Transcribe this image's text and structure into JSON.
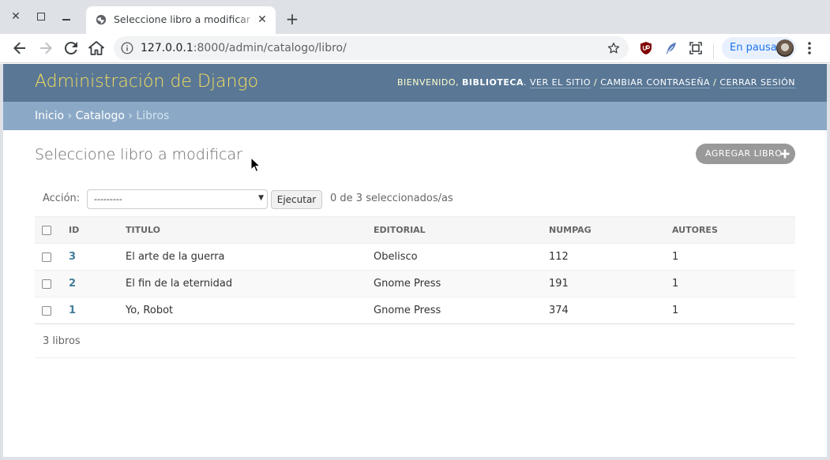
{
  "browser": {
    "tab_title": "Seleccione libro a modificar | Sitio de administración de Django",
    "url_host": "127.0.0.1",
    "url_rest": ":8000/admin/catalogo/libro/",
    "profile_label": "En pausa"
  },
  "header": {
    "brand": "Administración de Django",
    "welcome": "Bienvenido,",
    "username": "biblioteca",
    "view_site": "Ver el sitio",
    "change_password": "Cambiar contraseña",
    "logout": "Cerrar sesión",
    "sep": "/"
  },
  "breadcrumbs": {
    "home": "Inicio",
    "app": "Catalogo",
    "current": "Libros",
    "sep": "›"
  },
  "content": {
    "title": "Seleccione libro a modificar",
    "add_button": "Agregar libro"
  },
  "actions": {
    "label": "Acción:",
    "selected_option": "---------",
    "go_button": "Ejecutar",
    "counter": "0 de 3 seleccionados/as"
  },
  "table": {
    "columns": [
      "ID",
      "TITULO",
      "EDITORIAL",
      "NUMPAG",
      "AUTORES"
    ],
    "rows": [
      {
        "id": "3",
        "titulo": "El arte de la guerra",
        "editorial": "Obelisco",
        "numpag": "112",
        "autores": "1"
      },
      {
        "id": "2",
        "titulo": "El fin de la eternidad",
        "editorial": "Gnome Press",
        "numpag": "191",
        "autores": "1"
      },
      {
        "id": "1",
        "titulo": "Yo, Robot",
        "editorial": "Gnome Press",
        "numpag": "374",
        "autores": "1"
      }
    ]
  },
  "paginator": {
    "text": "3 libros"
  },
  "colors": {
    "header_bg": "#5a7896",
    "brand_yellow": "#f5dd5d",
    "breadcrumb_bg": "#8ba9c6",
    "link_blue": "#447e9b"
  }
}
